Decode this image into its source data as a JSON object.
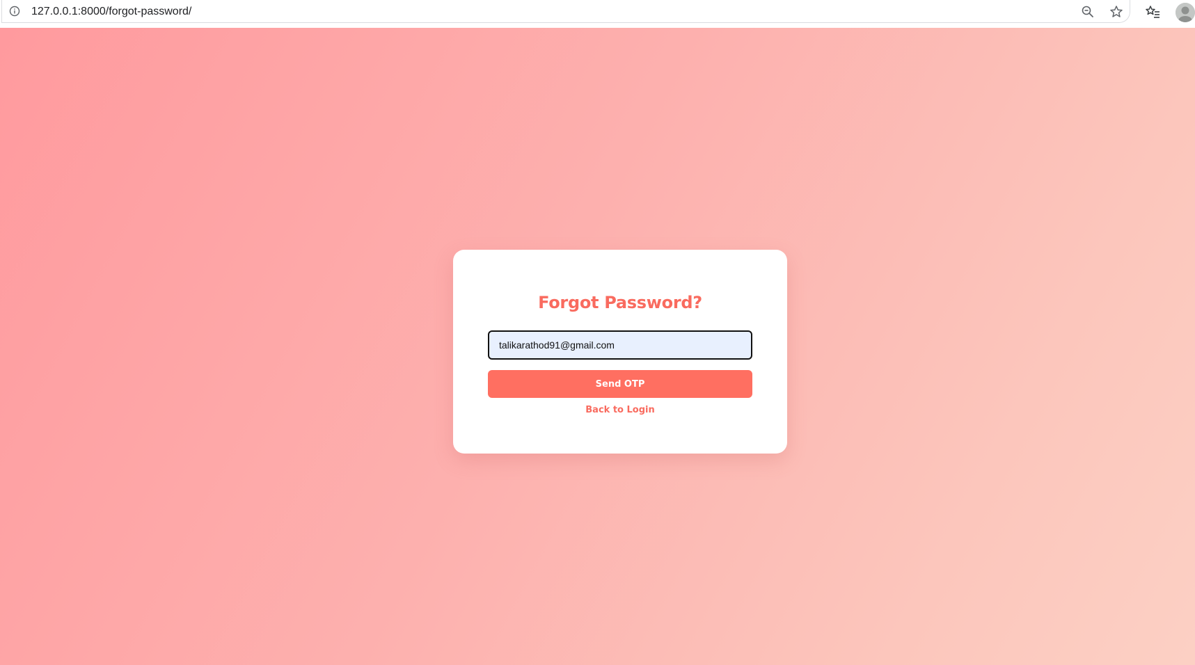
{
  "browser": {
    "url": "127.0.0.1:8000/forgot-password/",
    "icons": [
      "info-icon",
      "zoom-out-icon",
      "star-icon",
      "reading-list-icon",
      "profile-avatar"
    ]
  },
  "form": {
    "title": "Forgot Password?",
    "email_value": "talikarathod91@gmail.com",
    "submit_label": "Send OTP",
    "back_link_label": "Back to Login"
  },
  "colors": {
    "accent": "#ff6f61",
    "title": "#f96b5f",
    "input_bg": "#e8f0fe",
    "gradient_start": "#ff9a9e",
    "gradient_end": "#fcd0c4"
  }
}
